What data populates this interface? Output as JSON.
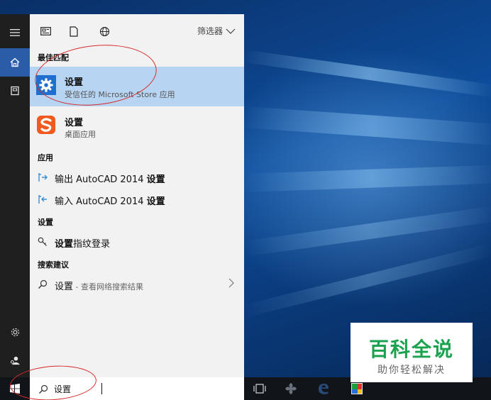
{
  "topbar": {
    "filter_label": "筛选器",
    "icons": [
      "document-grid-icon",
      "document-icon",
      "globe-icon"
    ]
  },
  "sections": {
    "best_match": "最佳匹配",
    "apps": "应用",
    "settings": "设置",
    "suggestions": "搜索建议"
  },
  "best_match": {
    "title": "设置",
    "subtitle": "受信任的 Microsoft Store 应用"
  },
  "second_result": {
    "title": "设置",
    "subtitle": "桌面应用"
  },
  "apps": [
    {
      "prefix": "输出 AutoCAD 2014 ",
      "bold": "设置"
    },
    {
      "prefix": "输入 AutoCAD 2014 ",
      "bold": "设置"
    }
  ],
  "settings_item": {
    "bold": "设置",
    "rest": "指纹登录"
  },
  "suggestion": {
    "bold": "设置",
    "rest": " - 查看网络搜索结果"
  },
  "search": {
    "value": "设置"
  },
  "watermark": {
    "title": "百科全说",
    "subtitle": "助你轻松解决"
  },
  "colors": {
    "rail": "#1f1f1f",
    "rail_active": "#2b5ca8",
    "panel": "#f2f2f2",
    "selected": "#b7d5f2",
    "settings_tile": "#1f6fd0",
    "sogou": "#f05a1e",
    "watermark_green": "#1aa24f"
  }
}
